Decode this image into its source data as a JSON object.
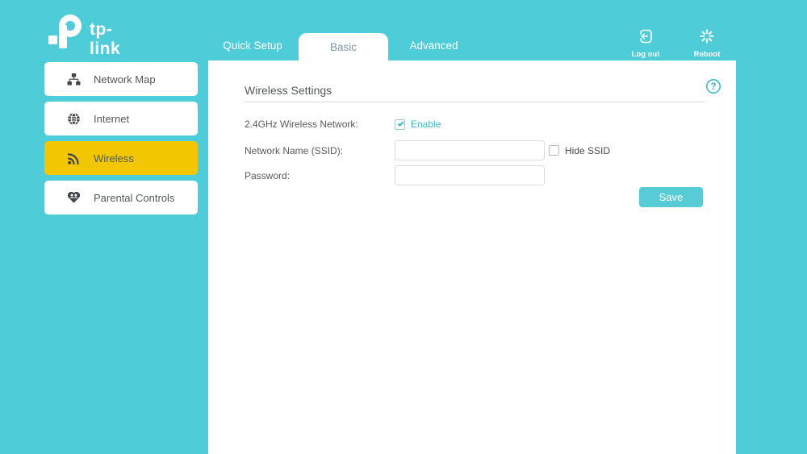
{
  "brand": {
    "name": "tp-link"
  },
  "header": {
    "tabs": [
      {
        "label": "Quick Setup",
        "active": false
      },
      {
        "label": "Basic",
        "active": true
      },
      {
        "label": "Advanced",
        "active": false
      }
    ],
    "logout_label": "Log out",
    "reboot_label": "Reboot"
  },
  "sidebar": {
    "items": [
      {
        "label": "Network Map",
        "icon": "network-map-icon",
        "selected": false
      },
      {
        "label": "Internet",
        "icon": "globe-icon",
        "selected": false
      },
      {
        "label": "Wireless",
        "icon": "wifi-icon",
        "selected": true
      },
      {
        "label": "Parental Controls",
        "icon": "heart-icon",
        "selected": false
      }
    ]
  },
  "main": {
    "title": "Wireless Settings",
    "rows": {
      "network": {
        "label": "2.4GHz Wireless Network:",
        "checkbox_label": "Enable",
        "checked": true
      },
      "ssid": {
        "label": "Network Name (SSID):",
        "value": "",
        "side_label": "Hide SSID",
        "side_checked": false
      },
      "password": {
        "label": "Password:",
        "value": ""
      }
    },
    "save_label": "Save"
  },
  "colors": {
    "teal_background": "#4ecdd9",
    "selected_yellow": "#f2c701",
    "accent_teal": "#3cb9c6",
    "save_button": "#57ccd6"
  }
}
